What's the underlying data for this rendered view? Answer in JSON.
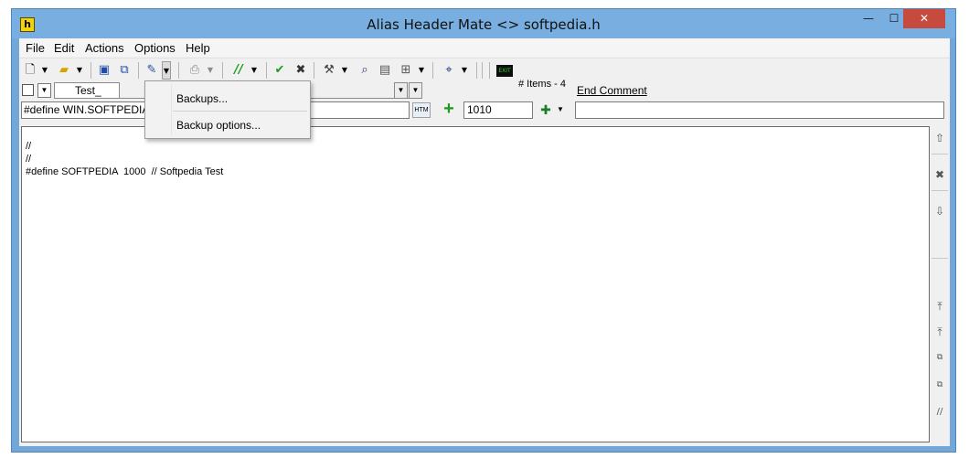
{
  "window": {
    "title": "Alias Header Mate <> softpedia.h",
    "app_icon_letter": "h",
    "controls": {
      "minimize": "—",
      "maximize": "☐",
      "close": "✕"
    }
  },
  "menu": [
    {
      "label": "File"
    },
    {
      "label": "Edit"
    },
    {
      "label": "Actions"
    },
    {
      "label": "Options"
    },
    {
      "label": "Help"
    }
  ],
  "row2": {
    "combo_value": "Test_",
    "items_label": "# Items - 4",
    "end_comment_label": "End Comment"
  },
  "row3": {
    "define_value": "#define WIN.SOFTPEDIA.0",
    "value": "1010",
    "end_comment_value": "",
    "htm_label": "HTM"
  },
  "editor": {
    "lines": [
      "//",
      "//",
      "#define SOFTPEDIA  1000  // Softpedia Test"
    ]
  },
  "popup": {
    "items": [
      "Backups...",
      "Backup options..."
    ]
  },
  "colors": {
    "title_bar": "#78aee0",
    "close_button": "#c74a3f",
    "accent_green": "#1b9a1b"
  },
  "icons": {
    "toolbar": [
      "new-file-icon",
      "open-folder-icon",
      "save-icon",
      "save-all-icon",
      "backup-icon",
      "print-icon",
      "comment-icon",
      "check-icon",
      "cancel-icon",
      "tools-icon",
      "find-icon",
      "view-icon",
      "image-edit-icon",
      "browse-icon",
      "exit-icon"
    ],
    "side": [
      "move-up-icon",
      "delete-icon",
      "move-down-icon",
      "move-top-icon",
      "move-top-alt-icon",
      "copy-icon",
      "copy-alt-icon",
      "comment-line-icon"
    ]
  }
}
